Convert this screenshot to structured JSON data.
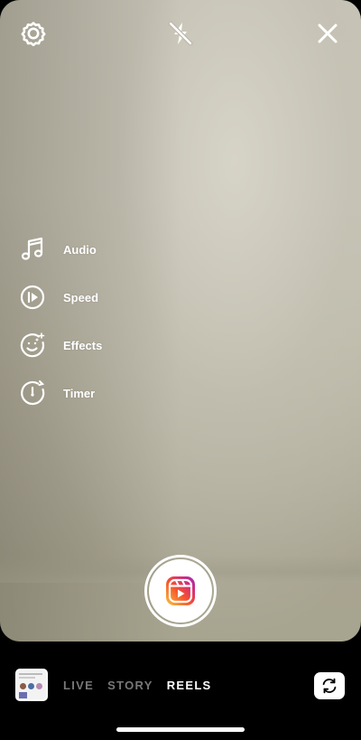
{
  "topbar": {
    "settings_icon": "settings-gear-icon",
    "flash_icon": "flash-off-icon",
    "close_icon": "close-icon"
  },
  "tools": [
    {
      "label": "Audio",
      "icon": "music-note-icon"
    },
    {
      "label": "Speed",
      "icon": "speed-play-icon"
    },
    {
      "label": "Effects",
      "icon": "effects-face-icon"
    },
    {
      "label": "Timer",
      "icon": "timer-icon"
    }
  ],
  "shutter": {
    "icon": "reels-icon"
  },
  "bottom": {
    "modes": [
      {
        "label": "LIVE",
        "active": false
      },
      {
        "label": "STORY",
        "active": false
      },
      {
        "label": "REELS",
        "active": true
      }
    ],
    "gallery_icon": "gallery-thumbnail",
    "flip_icon": "camera-flip-icon"
  },
  "colors": {
    "accent_white": "#ffffff",
    "inactive_mode": "#777777",
    "reels_gradient": [
      "#f9c53b",
      "#f4542e",
      "#d62976",
      "#962fbf"
    ]
  }
}
